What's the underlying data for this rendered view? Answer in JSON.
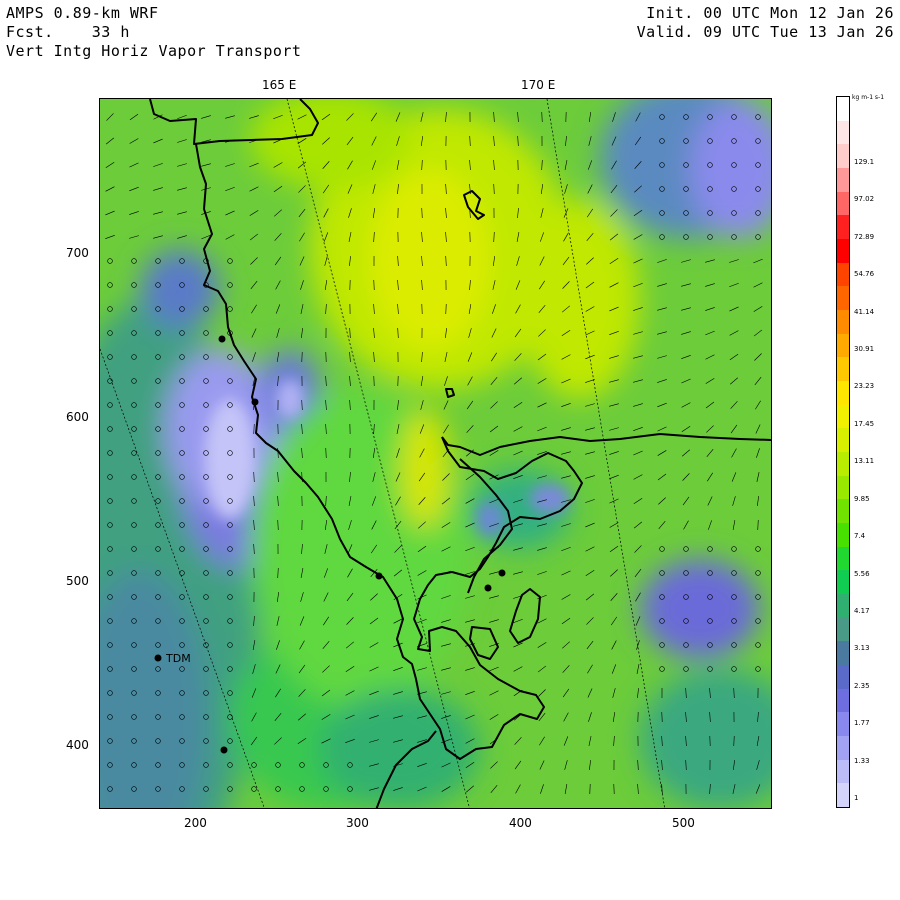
{
  "header": {
    "model": "AMPS 0.89-km WRF",
    "forecast": "Fcst.    33 h",
    "field": "Vert Intg Horiz Vapor Transport",
    "init": "Init. 00 UTC Mon 12 Jan 26",
    "valid": "Valid. 09 UTC Tue 13 Jan 26"
  },
  "map": {
    "lon_labels": [
      "165 E",
      "170 E"
    ],
    "x_ticks": [
      "200",
      "300",
      "400",
      "500"
    ],
    "y_ticks": [
      "700",
      "600",
      "500",
      "400"
    ],
    "station_label": "TDM"
  },
  "colorbar": {
    "units": "kg m-1 s-1",
    "labels": [
      "129.1",
      "97.02",
      "72.89",
      "54.76",
      "41.14",
      "30.91",
      "23.23",
      "17.45",
      "13.11",
      "9.85",
      "7.4",
      "5.56",
      "4.17",
      "3.13",
      "2.35",
      "1.77",
      "1.33",
      "1"
    ],
    "colors": [
      "#ffffff",
      "#ffe6e6",
      "#ffcccc",
      "#ff9999",
      "#ff6666",
      "#ff2020",
      "#ff0000",
      "#ff4400",
      "#ff6600",
      "#ff8c00",
      "#ffaa00",
      "#ffc800",
      "#ffe600",
      "#f0f000",
      "#d8f000",
      "#b8ec00",
      "#98e800",
      "#70e400",
      "#48e000",
      "#20d830",
      "#10cc50",
      "#30b070",
      "#4a9a88",
      "#4a7aa0",
      "#5a6ac8",
      "#6e6ee0",
      "#8888ee",
      "#a2a2f4",
      "#bcbcf8",
      "#d4d4fb"
    ]
  }
}
